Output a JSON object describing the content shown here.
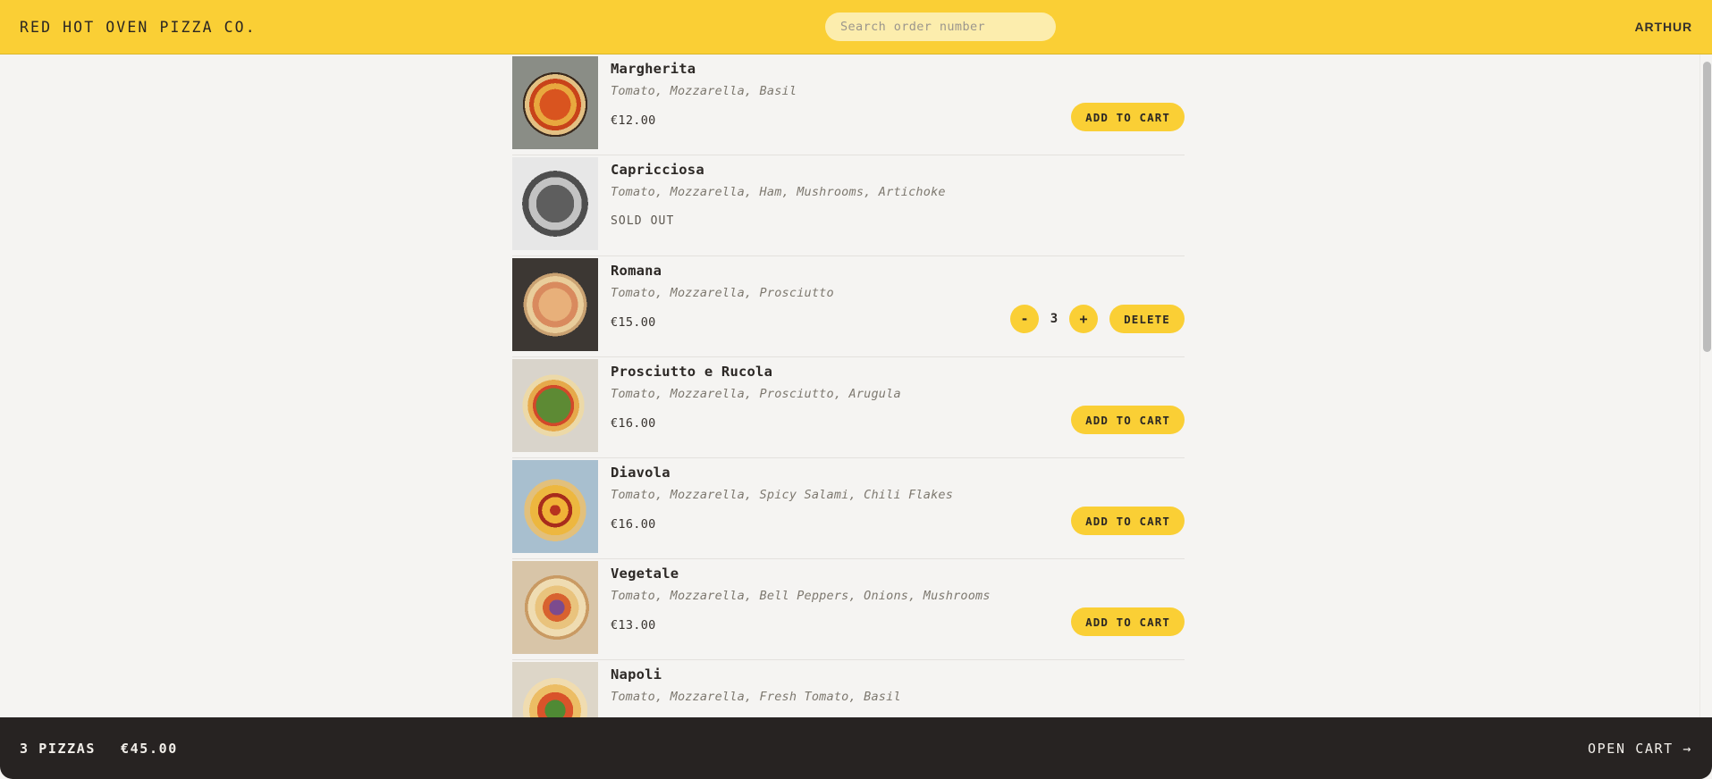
{
  "header": {
    "brand": "RED HOT OVEN PIZZA CO.",
    "search_placeholder": "Search order number",
    "search_value": "",
    "user": "ARTHUR",
    "accent_color": "#facf35"
  },
  "menu": {
    "items": [
      {
        "name": "Margherita",
        "description": "Tomato, Mozzarella, Basil",
        "price": "€12.00",
        "state": "available",
        "action_label": "ADD TO CART"
      },
      {
        "name": "Capricciosa",
        "description": "Tomato, Mozzarella, Ham, Mushrooms, Artichoke",
        "price": "",
        "state": "sold-out",
        "sold_out_label": "SOLD OUT",
        "action_label": ""
      },
      {
        "name": "Romana",
        "description": "Tomato, Mozzarella, Prosciutto",
        "price": "€15.00",
        "state": "in-cart",
        "quantity": "3",
        "decrement_label": "-",
        "increment_label": "+",
        "action_label": "DELETE"
      },
      {
        "name": "Prosciutto e Rucola",
        "description": "Tomato, Mozzarella, Prosciutto, Arugula",
        "price": "€16.00",
        "state": "available",
        "action_label": "ADD TO CART"
      },
      {
        "name": "Diavola",
        "description": "Tomato, Mozzarella, Spicy Salami, Chili Flakes",
        "price": "€16.00",
        "state": "available",
        "action_label": "ADD TO CART"
      },
      {
        "name": "Vegetale",
        "description": "Tomato, Mozzarella, Bell Peppers, Onions, Mushrooms",
        "price": "€13.00",
        "state": "available",
        "action_label": "ADD TO CART"
      },
      {
        "name": "Napoli",
        "description": "Tomato, Mozzarella, Fresh Tomato, Basil",
        "price": "",
        "state": "available",
        "action_label": ""
      }
    ]
  },
  "footer": {
    "item_count_label": "3 PIZZAS",
    "total_label": "€45.00",
    "open_cart_label": "OPEN CART →",
    "background_color": "#272322"
  }
}
